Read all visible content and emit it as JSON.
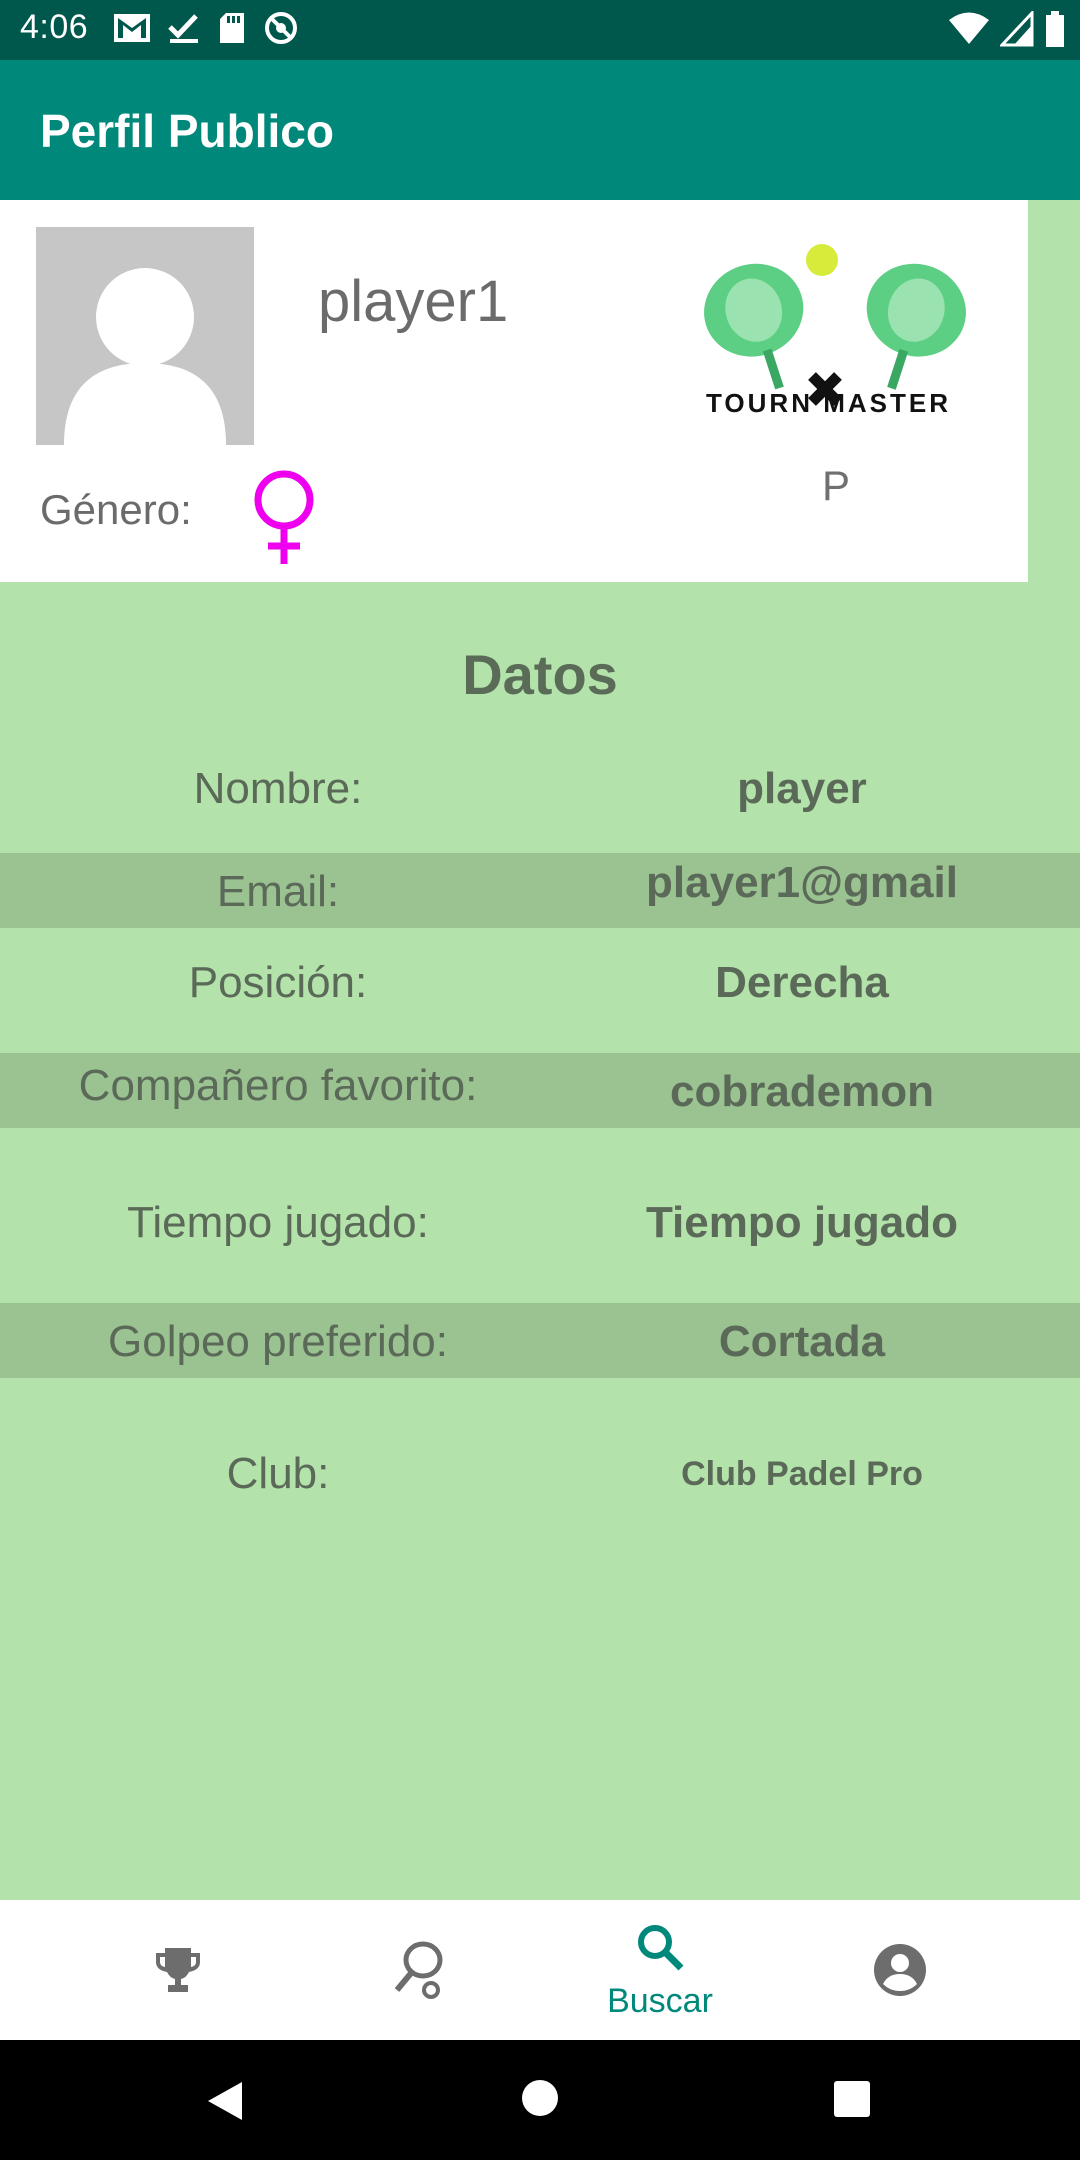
{
  "status_bar": {
    "time": "4:06",
    "icons_left": [
      "gmail-icon",
      "checkmark-icon",
      "sd-card-icon",
      "sync-disabled-icon"
    ],
    "icons_right": [
      "wifi-icon",
      "cell-signal-icon",
      "battery-icon"
    ]
  },
  "app_bar": {
    "title": "Perfil Publico"
  },
  "profile": {
    "username": "player1",
    "logo_text": "TOURN MASTER",
    "position_letter": "P",
    "gender_label": "Género:",
    "gender_icon": "female-symbol-icon",
    "gender_color": "#ee00ee"
  },
  "datos": {
    "title": "Datos",
    "rows": [
      {
        "label": "Nombre:",
        "value": "player"
      },
      {
        "label": "Email:",
        "value": "player1@gmail"
      },
      {
        "label": "Posición:",
        "value": "Derecha"
      },
      {
        "label": "Compañero favorito:",
        "value": "cobrademon"
      },
      {
        "label": "Tiempo jugado:",
        "value": "Tiempo jugado"
      },
      {
        "label": "Golpeo preferido:",
        "value": "Cortada"
      },
      {
        "label": "Club:",
        "value": "Club Padel Pro"
      }
    ]
  },
  "bottom_nav": {
    "items": [
      {
        "icon": "trophy-icon",
        "label": ""
      },
      {
        "icon": "padel-racket-icon",
        "label": ""
      },
      {
        "icon": "search-icon",
        "label": "Buscar",
        "active": true
      },
      {
        "icon": "account-circle-icon",
        "label": ""
      }
    ]
  },
  "system_nav": {
    "icons": [
      "back-icon",
      "home-icon",
      "recents-icon"
    ]
  },
  "colors": {
    "status_bar": "#00574b",
    "app_bar": "#00897b",
    "background": "#b3e3aa",
    "row_stripe": "#9bc291",
    "accent": "#00897b"
  }
}
